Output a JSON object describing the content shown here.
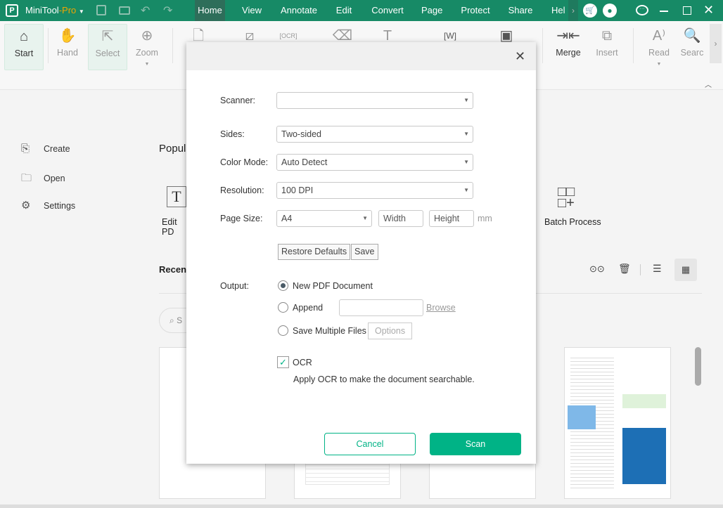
{
  "app": {
    "name": "MiniTool",
    "suffix": "-Pro"
  },
  "menu": [
    "Home",
    "View",
    "Annotate",
    "Edit",
    "Convert",
    "Page",
    "Protect",
    "Share",
    "Help"
  ],
  "toolbar": {
    "start": "Start",
    "hand": "Hand",
    "select": "Select",
    "zoom": "Zoom",
    "merge": "Merge",
    "insert": "Insert",
    "read": "Read",
    "search": "Searc"
  },
  "sidebar": [
    {
      "label": "Create",
      "icon": "create-icon"
    },
    {
      "label": "Open",
      "icon": "folder-icon"
    },
    {
      "label": "Settings",
      "icon": "gear-icon"
    }
  ],
  "main": {
    "popular": "Popul",
    "edit_pdf": "Edit PD",
    "batch": "Batch Process",
    "recent": "Recent",
    "search_placeholder": "S"
  },
  "dialog": {
    "scanner_label": "Scanner:",
    "scanner_value": "",
    "sides_label": "Sides:",
    "sides_value": "Two-sided",
    "color_label": "Color Mode:",
    "color_value": "Auto Detect",
    "resolution_label": "Resolution:",
    "resolution_value": "100 DPI",
    "pagesize_label": "Page Size:",
    "pagesize_value": "A4",
    "width_placeholder": "Width",
    "height_placeholder": "Height",
    "unit": "mm",
    "restore": "Restore Defaults",
    "save": "Save",
    "output_label": "Output:",
    "new_pdf": "New PDF Document",
    "append": "Append",
    "browse": "Browse",
    "multiple": "Save Multiple Files",
    "options": "Options",
    "ocr": "OCR",
    "ocr_checked": true,
    "ocr_desc": "Apply OCR to make the document searchable.",
    "cancel": "Cancel",
    "scan": "Scan"
  },
  "colors": {
    "brand": "#178a66",
    "accent": "#00b386"
  }
}
